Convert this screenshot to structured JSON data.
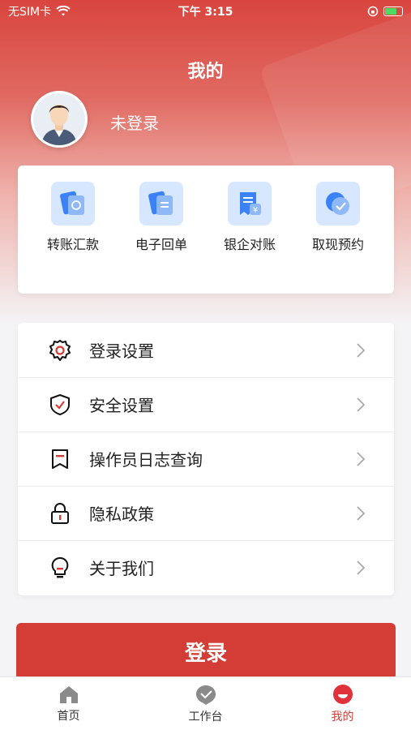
{
  "status_bar": {
    "carrier": "无SIM卡",
    "time": "下午 3:15"
  },
  "header": {
    "title": "我的",
    "login_status": "未登录"
  },
  "quick_actions": [
    {
      "label": "转账汇款",
      "icon": "transfer-icon"
    },
    {
      "label": "电子回单",
      "icon": "receipt-icon"
    },
    {
      "label": "银企对账",
      "icon": "reconciliation-icon"
    },
    {
      "label": "取现预约",
      "icon": "cash-appointment-icon"
    }
  ],
  "menu": [
    {
      "label": "登录设置",
      "icon": "gear-icon"
    },
    {
      "label": "安全设置",
      "icon": "shield-icon"
    },
    {
      "label": "操作员日志查询",
      "icon": "log-icon"
    },
    {
      "label": "隐私政策",
      "icon": "lock-icon"
    },
    {
      "label": "关于我们",
      "icon": "lightbulb-icon"
    }
  ],
  "login_button": "登录",
  "tabs": [
    {
      "label": "首页",
      "icon": "home-icon",
      "active": false
    },
    {
      "label": "工作台",
      "icon": "workbench-icon",
      "active": false
    },
    {
      "label": "我的",
      "icon": "profile-icon",
      "active": true
    }
  ],
  "colors": {
    "accent": "#d43d35",
    "icon_bg": "#d7e7ff",
    "icon_blue": "#3b82f6"
  }
}
